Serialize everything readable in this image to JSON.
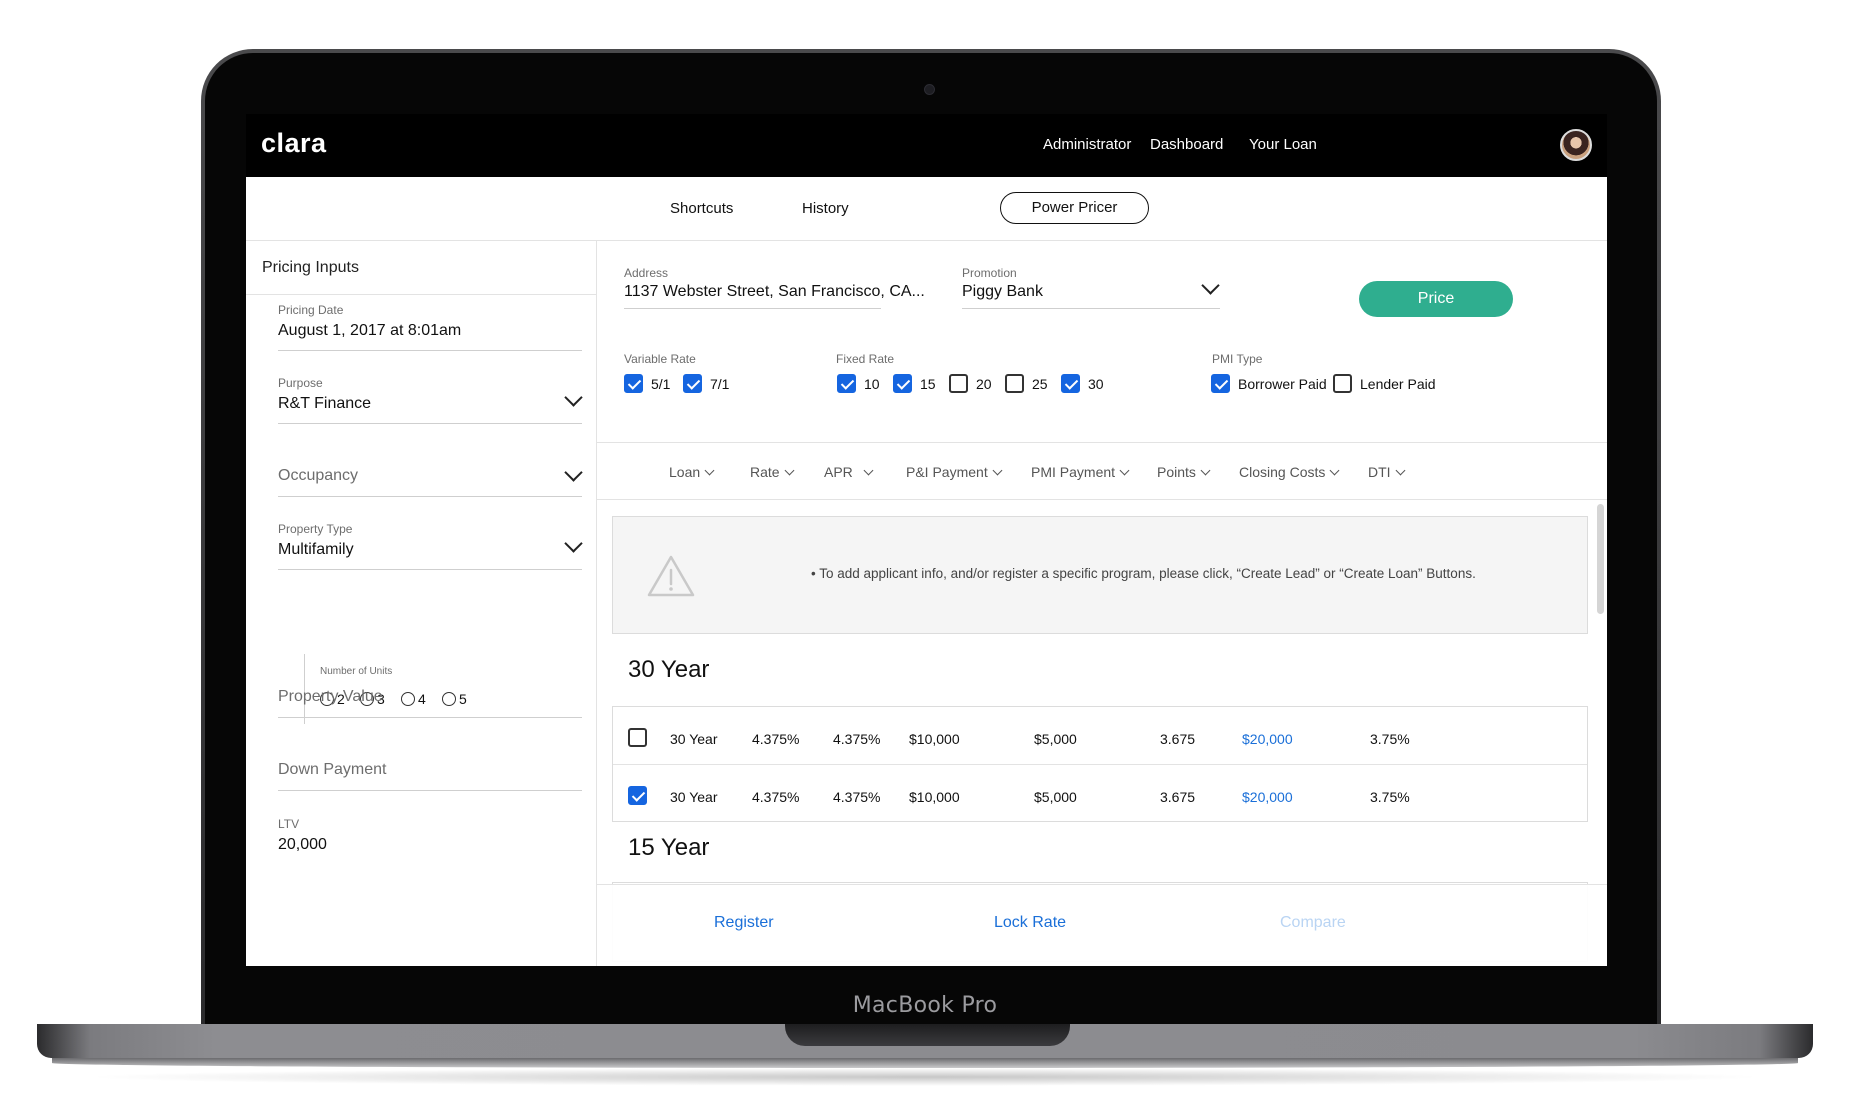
{
  "device": {
    "label": "MacBook Pro"
  },
  "app": {
    "logo": "clara"
  },
  "topnav": {
    "items": [
      "Administrator",
      "Dashboard",
      "Your Loan"
    ]
  },
  "subnav": {
    "tabs": [
      "Shortcuts",
      "History",
      "Power Pricer"
    ],
    "active": "Power Pricer"
  },
  "left_panel": {
    "title": "Pricing Inputs",
    "pricing_date": {
      "label": "Pricing Date",
      "value": "August 1, 2017 at 8:01am"
    },
    "purpose": {
      "label": "Purpose",
      "value": "R&T Finance"
    },
    "occupancy": {
      "placeholder": "Occupancy"
    },
    "property_type": {
      "label": "Property Type",
      "value": "Multifamily"
    },
    "units": {
      "label": "Number of Units",
      "options": [
        "2",
        "3",
        "4",
        "5"
      ]
    },
    "property_value": {
      "placeholder": "Property Value"
    },
    "down_payment": {
      "placeholder": "Down Payment"
    },
    "ltv": {
      "label": "LTV",
      "value": "20,000"
    }
  },
  "right_panel": {
    "address": {
      "label": "Address",
      "value": "1137 Webster Street, San Francisco, CA..."
    },
    "promotion": {
      "label": "Promotion",
      "value": "Piggy Bank"
    },
    "price_button": "Price",
    "variable_rate": {
      "label": "Variable Rate",
      "options": [
        {
          "label": "5/1",
          "checked": true
        },
        {
          "label": "7/1",
          "checked": true
        }
      ]
    },
    "fixed_rate": {
      "label": "Fixed Rate",
      "options": [
        {
          "label": "10",
          "checked": true
        },
        {
          "label": "15",
          "checked": true
        },
        {
          "label": "20",
          "checked": false
        },
        {
          "label": "25",
          "checked": false
        },
        {
          "label": "30",
          "checked": true
        }
      ]
    },
    "pmi_type": {
      "label": "PMI Type",
      "options": [
        {
          "label": "Borrower Paid",
          "checked": true
        },
        {
          "label": "Lender Paid",
          "checked": false
        }
      ]
    },
    "columns": [
      "Loan",
      "Rate",
      "APR",
      "P&I Payment",
      "PMI Payment",
      "Points",
      "Closing Costs",
      "DTI"
    ],
    "alert": "• To add applicant info, and/or register a specific program, please click, “Create Lead” or “Create Loan” Buttons.",
    "sections": [
      {
        "title": "30 Year",
        "rows": [
          {
            "checked": false,
            "loan": "30 Year",
            "rate": "4.375%",
            "apr": "4.375%",
            "pi": "$10,000",
            "pmi": "$5,000",
            "points": "3.675",
            "closing": "$20,000",
            "dti": "3.75%"
          },
          {
            "checked": true,
            "loan": "30 Year",
            "rate": "4.375%",
            "apr": "4.375%",
            "pi": "$10,000",
            "pmi": "$5,000",
            "points": "3.675",
            "closing": "$20,000",
            "dti": "3.75%"
          }
        ]
      },
      {
        "title": "15 Year",
        "rows": []
      }
    ],
    "actions": {
      "register": "Register",
      "lock_rate": "Lock Rate",
      "compare": "Compare"
    }
  },
  "colors": {
    "accent": "#2fae8f",
    "link": "#1a6fd8",
    "checkbox": "#1565e0",
    "topbar": "#000000"
  }
}
